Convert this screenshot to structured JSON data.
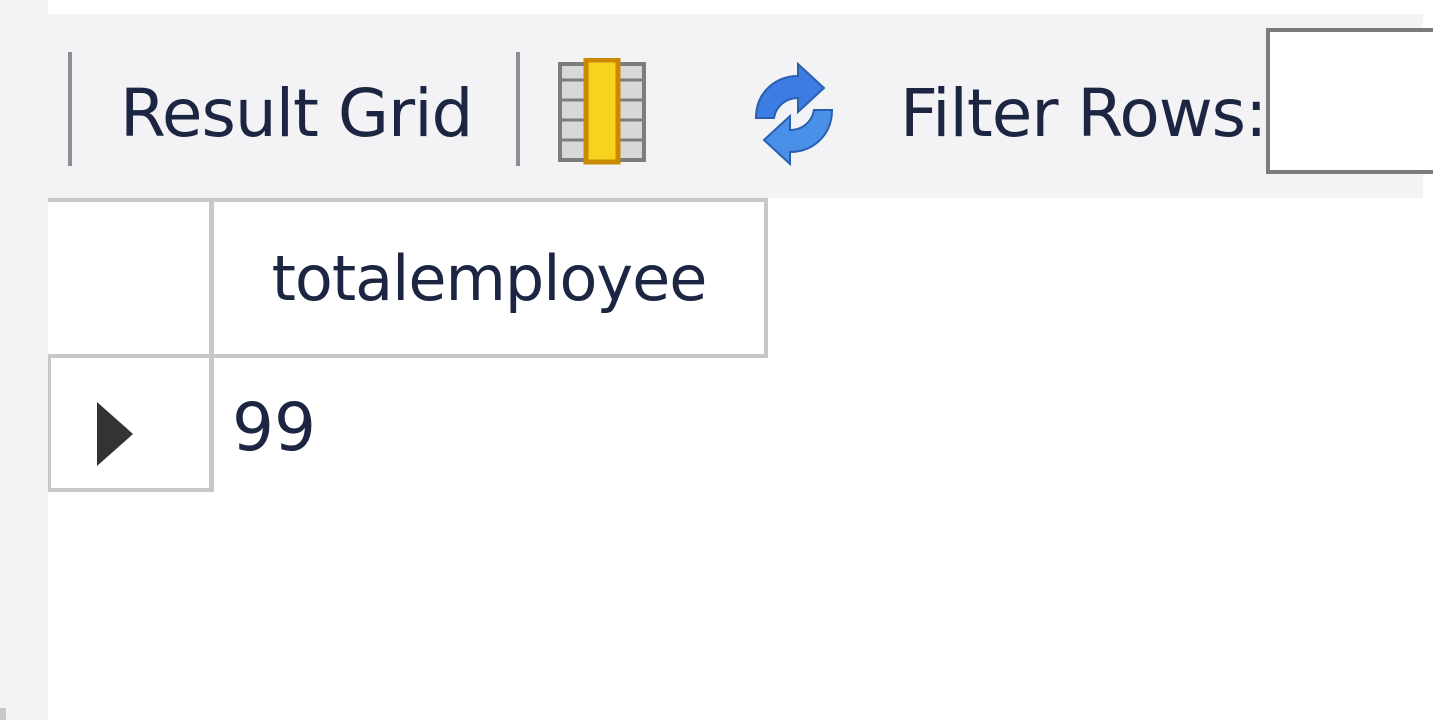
{
  "toolbar": {
    "result_grid_label": "Result Grid",
    "filter_label": "Filter Rows:",
    "filter_value": ""
  },
  "grid": {
    "columns": [
      "totalemployee"
    ],
    "rows": [
      [
        "99"
      ]
    ]
  },
  "colors": {
    "toolbar_bg": "#f3f3f5",
    "text": "#1c2541",
    "grid_border": "#c8c8c8",
    "refresh_blue": "#3b7de0",
    "toggle_yellow": "#f7d21e"
  },
  "icons": {
    "grid_toggle": "result-grid-toggle-icon",
    "refresh": "refresh-icon",
    "row_marker": "row-marker-arrow-icon"
  }
}
